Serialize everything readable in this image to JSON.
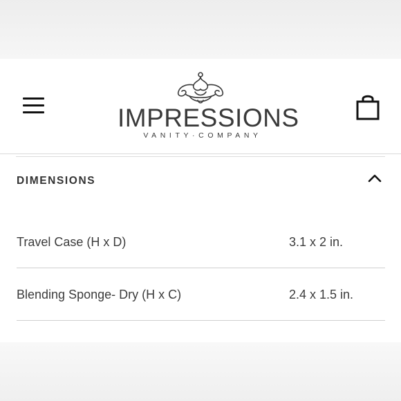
{
  "header": {
    "menu_icon": "hamburger-menu-icon",
    "logo": {
      "name": "IMPRESSIONS",
      "tagline": "VANITY·COMPANY"
    },
    "bag_icon": "shopping-bag-icon"
  },
  "section": {
    "title": "DIMENSIONS",
    "toggle_icon": "chevron-up-icon",
    "expanded": true
  },
  "dimensions": [
    {
      "label": "Travel Case (H x D)",
      "value": "3.1 x 2 in."
    },
    {
      "label": "Blending Sponge- Dry (H x C)",
      "value": "2.4 x 1.5 in."
    }
  ]
}
